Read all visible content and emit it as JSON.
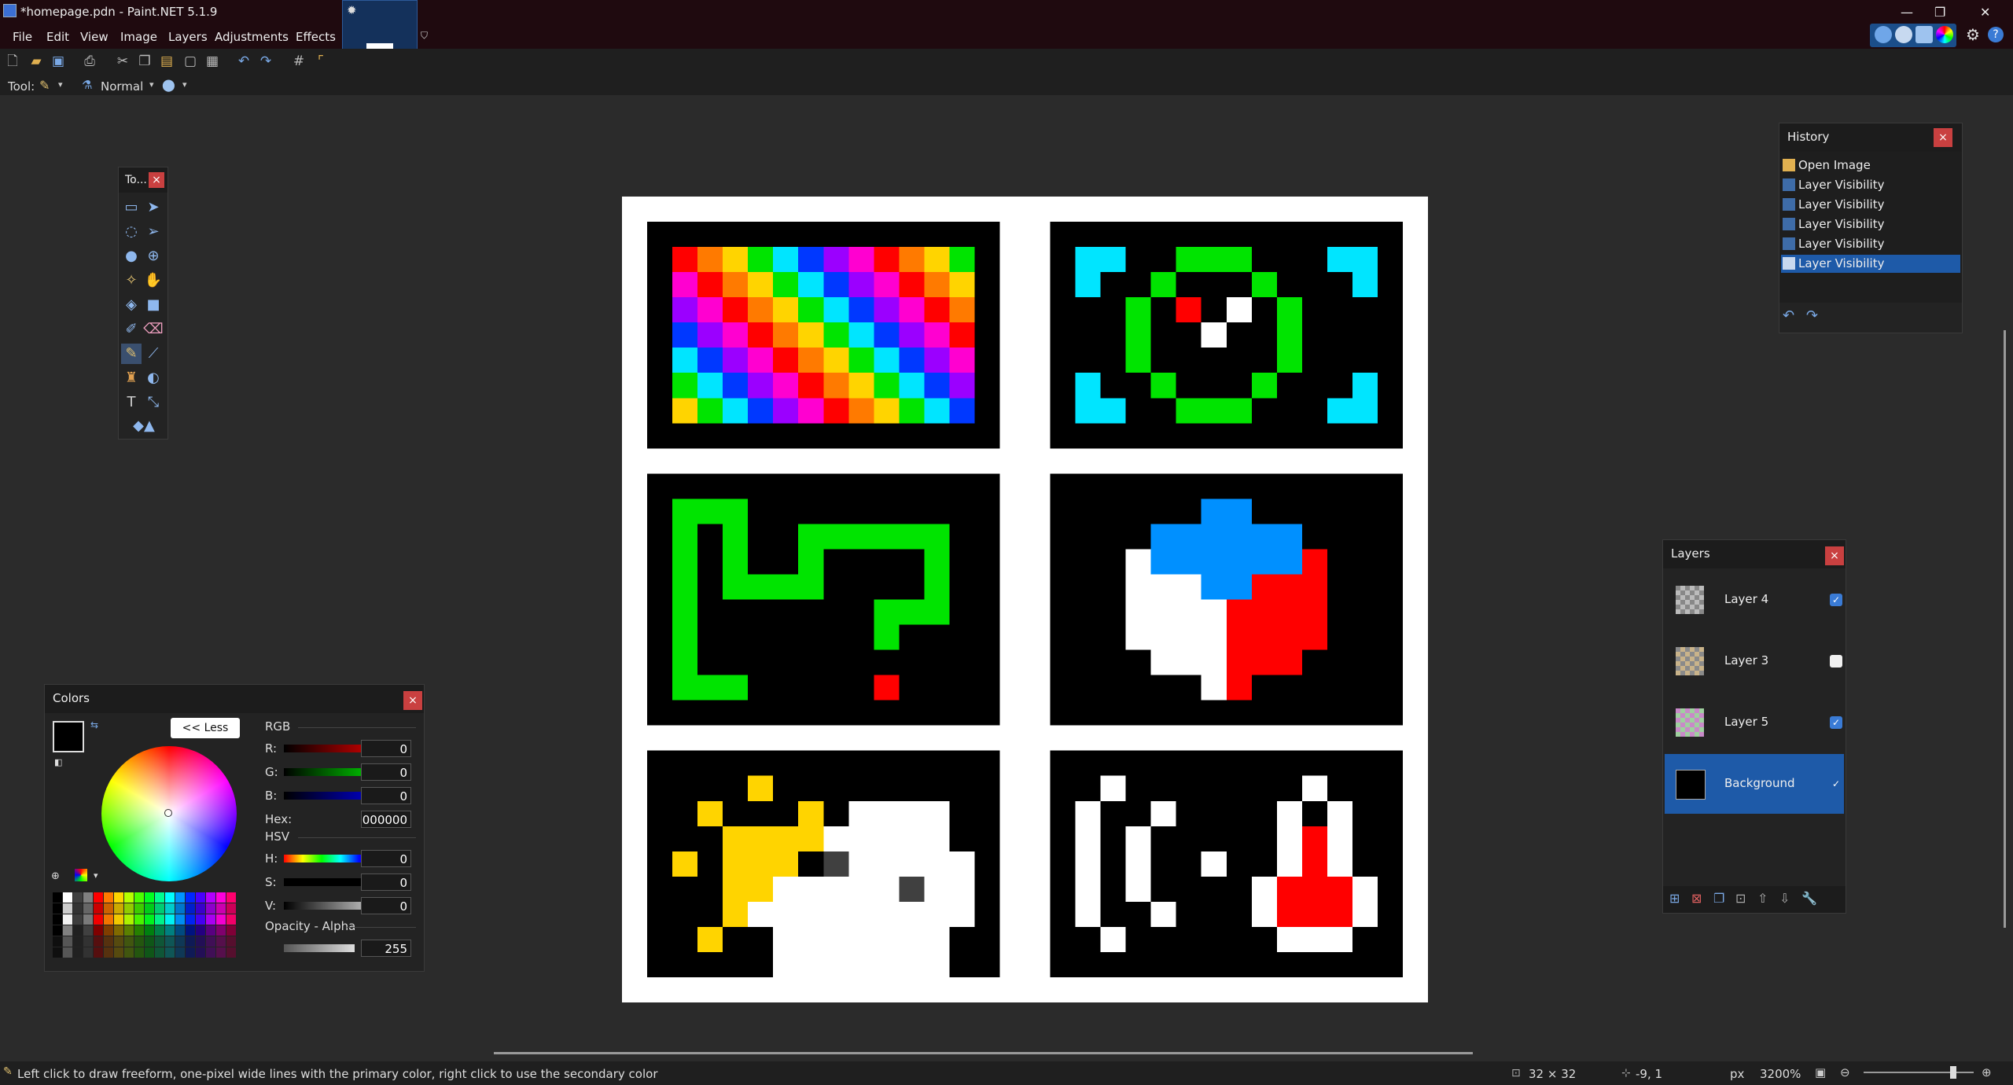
{
  "window": {
    "title": "*homepage.pdn - Paint.NET 5.1.9",
    "min_label": "—",
    "max_label": "❐",
    "close_label": "✕"
  },
  "menu": {
    "items": [
      "File",
      "Edit",
      "View",
      "Image",
      "Layers",
      "Adjustments",
      "Effects"
    ]
  },
  "toolbar": {
    "tool_label": "Tool:",
    "blend_mode": "Normal"
  },
  "tools_window": {
    "title": "To...",
    "close": "×"
  },
  "history": {
    "title": "History",
    "close": "×",
    "items": [
      "Open Image",
      "Layer Visibility",
      "Layer Visibility",
      "Layer Visibility",
      "Layer Visibility",
      "Layer Visibility"
    ],
    "selected_index": 5
  },
  "layers": {
    "title": "Layers",
    "close": "×",
    "items": [
      {
        "name": "Layer 4",
        "visible": true
      },
      {
        "name": "Layer 3",
        "visible": false
      },
      {
        "name": "Layer 5",
        "visible": true
      },
      {
        "name": "Background",
        "visible": true
      }
    ],
    "selected_index": 3
  },
  "colors": {
    "title": "Colors",
    "close": "×",
    "less_button": "<< Less",
    "rgb_label": "RGB",
    "r_label": "R:",
    "g_label": "G:",
    "b_label": "B:",
    "r_value": "0",
    "g_value": "0",
    "b_value": "0",
    "hex_label": "Hex:",
    "hex_value": "000000",
    "hsv_label": "HSV",
    "h_label": "H:",
    "s_label": "S:",
    "v_label": "V:",
    "h_value": "0",
    "s_value": "0",
    "v_value": "0",
    "opacity_label": "Opacity - Alpha",
    "opacity_value": "255",
    "primary_color": "#000000",
    "secondary_color": "#ffffff"
  },
  "status": {
    "hint": "Left click to draw freeform, one-pixel wide lines with the primary color, right click to use the secondary color",
    "image_size": "32 × 32",
    "cursor_pos": "-9, 1",
    "units": "px",
    "zoom": "3200%"
  },
  "accent_color": "#1e5aa8"
}
